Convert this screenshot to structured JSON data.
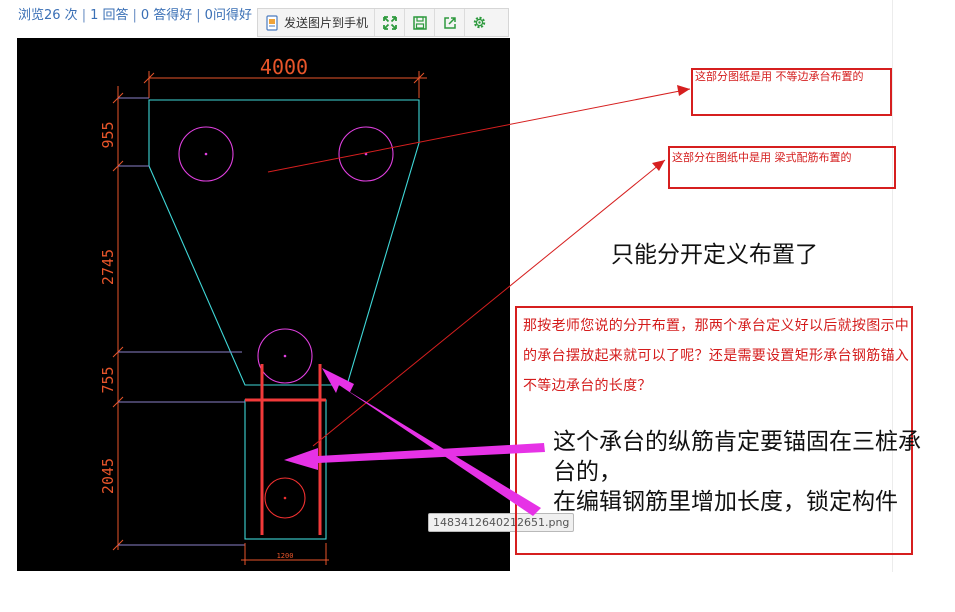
{
  "stats": {
    "views": "浏览26 次",
    "answers": "1 回答",
    "good": "0 答得好",
    "q_good": "0问得好"
  },
  "toolbar": {
    "send_label": "发送图片到手机",
    "icons": [
      "send-to-phone-icon",
      "fullscreen-icon",
      "save-icon",
      "share-icon",
      "settings-icon"
    ]
  },
  "drawing": {
    "dim_top": "4000",
    "dim_left": [
      "955",
      "2745",
      "755",
      "2045"
    ],
    "dim_bottom": "1200"
  },
  "notes": {
    "note1": "这部分图纸是用 不等边承台布置的",
    "note2": "这部分在图纸中是用 梁式配筋布置的",
    "answer1": "只能分开定义布置了",
    "question": "那按老师您说的分开布置，那两个承台定义好以后就按图示中的承台摆放起来就可以了呢？还是需要设置矩形承台钢筋锚入不等边承台的长度？",
    "answer2_line1": "这个承台的纵筋肯定要锚固在三桩承",
    "answer2_line2": "台的，",
    "answer2_line3": "在编辑钢筋里增加长度，锁定构件"
  },
  "filename": "1483412640212651.png",
  "colors": {
    "link": "#3a6fb5",
    "annotation_red": "#d61f1f",
    "cad_cyan": "#3fd7d7",
    "cad_magenta": "#e040e0",
    "cad_rebar": "#f23a3a",
    "cad_dim": "#e8552a",
    "cad_dim_line": "#8a7fc9",
    "arrow_magenta": "#e632e6"
  }
}
